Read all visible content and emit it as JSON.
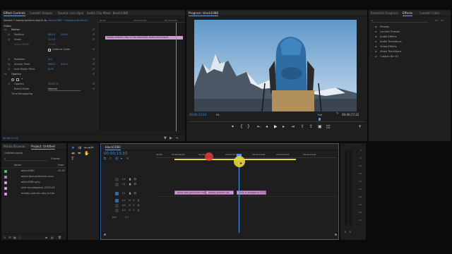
{
  "source_panel": {
    "tabs": [
      "Effect Controls",
      "Lumetri Scopes",
      "Source: (no clips)",
      "Audio Clip Mixer: black1080"
    ],
    "source_label": "Source * moody-autumn-day-in-fo...",
    "sequence_label": "black1080 * moody-autumn-d...",
    "ruler_times": [
      "00;00",
      "00;00;05;00",
      "00;00;10;00"
    ],
    "clip_chip": "moody-autumn-day-in-the-dolomites-forest-and-mount...",
    "video_header": "Video",
    "motion_header": "Motion",
    "rows": [
      {
        "label": "Position",
        "v1": "960.0",
        "v2": "540.0"
      },
      {
        "label": "Scale",
        "v1": "113.0",
        "v2": ""
      },
      {
        "label": "Scale Width",
        "v1": "100.0",
        "v2": ""
      },
      {
        "label": "Uniform Scale",
        "v1": "",
        "v2": ""
      },
      {
        "label": "Rotation",
        "v1": "0.0",
        "v2": ""
      },
      {
        "label": "Anchor Point",
        "v1": "960.0",
        "v2": "540.0"
      },
      {
        "label": "Anti-flicker Filter",
        "v1": "0.00",
        "v2": ""
      }
    ],
    "opacity_header": "Opacity",
    "opacity_value": "100.0 %",
    "blend_label": "Blend Mode",
    "blend_value": "Normal",
    "time_remap": "Time Remapping",
    "footer_time": "00;00;11;00"
  },
  "program_panel": {
    "title": "Program: black1080",
    "timecode_left": "00;00;13;10",
    "fit_label": "Fit",
    "full_label": "Full",
    "timecode_right": "00;00;17;22"
  },
  "effects_panel": {
    "tabs": [
      "Essential Graphics",
      "Effects",
      "Lumetri Color"
    ],
    "folders": [
      "Presets",
      "Lumetri Presets",
      "Audio Effects",
      "Audio Transitions",
      "Video Effects",
      "Video Transitions",
      "Custom Bin 01"
    ]
  },
  "project_panel": {
    "tabs": [
      "Media Browser",
      "Project: Untitled"
    ],
    "project_name": "Untitled.prproj",
    "items_label": "5 items",
    "col_name": "Name",
    "col_fps": "Fram",
    "items": [
      {
        "name": "black1080",
        "fps": "29.97",
        "color": "#4fbf6a"
      },
      {
        "name": "black-jazz-performer.mov",
        "fps": "",
        "color": "#a87fd6"
      },
      {
        "name": "black1080.png",
        "fps": "",
        "color": "#e09ae0"
      },
      {
        "name": "hike-in-patagonia-2022-01",
        "fps": "",
        "color": "#e09ae0"
      },
      {
        "name": "moody-autumn-day-in-the",
        "fps": "",
        "color": "#e09ae0"
      }
    ]
  },
  "timeline_panel": {
    "tab": "black1080",
    "timecode": "00;00;13;10",
    "ruler": [
      "00;00",
      "00;00;04;00",
      "00;00;08;00",
      "00;00;12;00",
      "00;00;16;00",
      "00;00;20;00",
      "00;00;24;00"
    ],
    "video_tracks": [
      "V3",
      "V2",
      "V1"
    ],
    "audio_tracks": [
      "A1",
      "A2",
      "A3"
    ],
    "master_label": "Mix",
    "master_value": "0.0",
    "clips": [
      {
        "label": "black-jazz-performer.mo"
      },
      {
        "label": "moody-autumn-da"
      },
      {
        "label": "hike-in-patagonia-2022-01"
      }
    ]
  },
  "meters": {
    "ticks": [
      "0",
      "-6",
      "-12",
      "-18",
      "-24",
      "-30",
      "-36",
      "-42",
      "-48",
      "-54"
    ],
    "footer": [
      "S",
      "S"
    ]
  },
  "colors": {
    "accent_blue": "#3f8fe0",
    "clip_pink": "#d29ad4",
    "playhead_blue": "#4a9ae8",
    "cursor_yellow": "#e6d73a",
    "marker_red": "#e03a3a"
  }
}
